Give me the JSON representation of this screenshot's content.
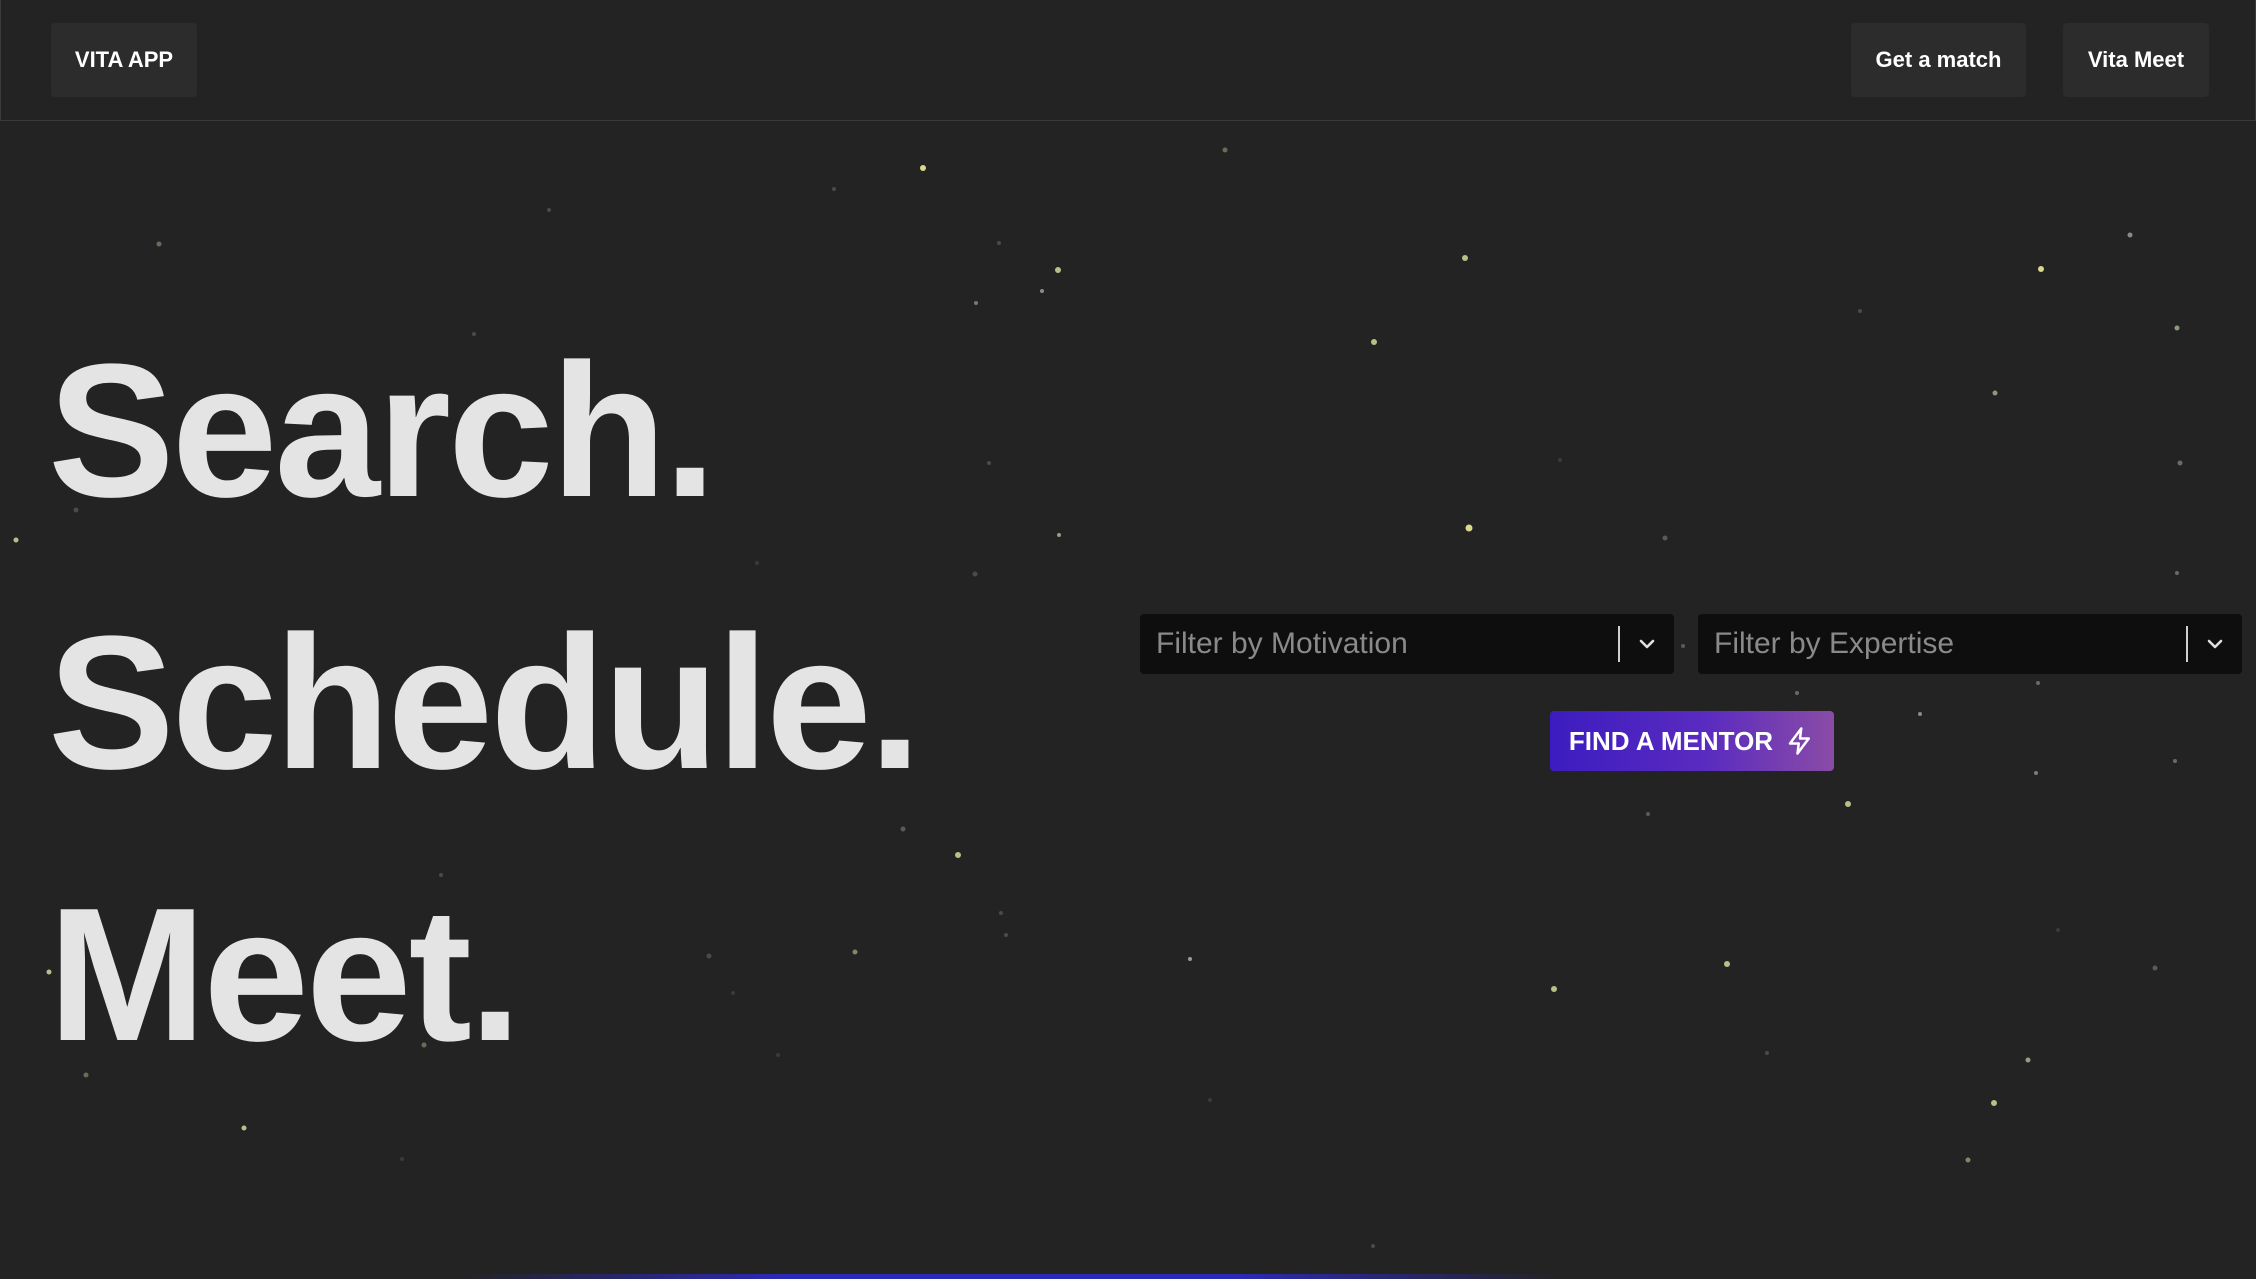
{
  "nav": {
    "brand": "VITA APP",
    "get_match": "Get a match",
    "vita_meet": "Vita Meet"
  },
  "hero": {
    "line1": "Search.",
    "line2": "Schedule.",
    "line3": "Meet."
  },
  "filters": {
    "motivation_placeholder": "Filter by Motivation",
    "expertise_placeholder": "Filter by Expertise"
  },
  "cta": {
    "label": "FIND A MENTOR",
    "icon": "lightning-bolt-icon"
  },
  "colors": {
    "background": "#232323",
    "text": "#e4e4e4",
    "select_bg": "#0e0e0e",
    "button_gradient_start": "#3c1cc0",
    "button_gradient_end": "#8a4ca6",
    "star_yellow": "#d8d98c",
    "star_grey": "#5a5a5a"
  }
}
